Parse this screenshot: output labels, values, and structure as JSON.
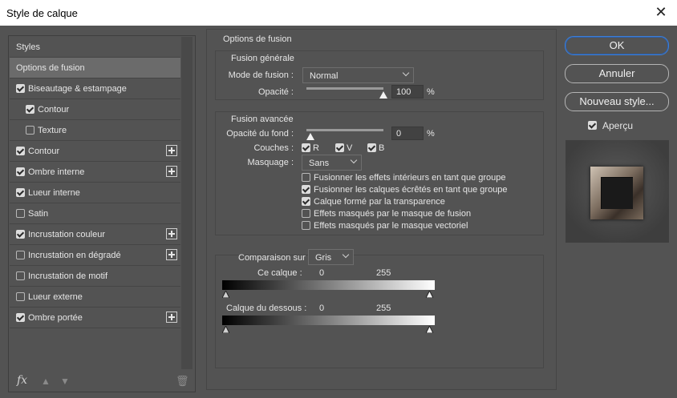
{
  "window": {
    "title": "Style de calque"
  },
  "sidebar": {
    "items": [
      {
        "label": "Styles",
        "checkbox": null,
        "plus": false,
        "selected": false,
        "indent": 0
      },
      {
        "label": "Options de fusion",
        "checkbox": null,
        "plus": false,
        "selected": true,
        "indent": 0
      },
      {
        "label": "Biseautage & estampage",
        "checkbox": true,
        "plus": false,
        "selected": false,
        "indent": 0
      },
      {
        "label": "Contour",
        "checkbox": true,
        "plus": false,
        "selected": false,
        "indent": 1
      },
      {
        "label": "Texture",
        "checkbox": false,
        "plus": false,
        "selected": false,
        "indent": 1
      },
      {
        "label": "Contour",
        "checkbox": true,
        "plus": true,
        "selected": false,
        "indent": 0
      },
      {
        "label": "Ombre interne",
        "checkbox": true,
        "plus": true,
        "selected": false,
        "indent": 0
      },
      {
        "label": "Lueur interne",
        "checkbox": true,
        "plus": false,
        "selected": false,
        "indent": 0
      },
      {
        "label": "Satin",
        "checkbox": false,
        "plus": false,
        "selected": false,
        "indent": 0
      },
      {
        "label": "Incrustation couleur",
        "checkbox": true,
        "plus": true,
        "selected": false,
        "indent": 0
      },
      {
        "label": "Incrustation en dégradé",
        "checkbox": false,
        "plus": true,
        "selected": false,
        "indent": 0
      },
      {
        "label": "Incrustation de motif",
        "checkbox": false,
        "plus": false,
        "selected": false,
        "indent": 0
      },
      {
        "label": "Lueur externe",
        "checkbox": false,
        "plus": false,
        "selected": false,
        "indent": 0
      },
      {
        "label": "Ombre portée",
        "checkbox": true,
        "plus": true,
        "selected": false,
        "indent": 0
      }
    ],
    "footer": {
      "fx_icon": "fx-icon",
      "up_icon": "arrow-up-icon",
      "down_icon": "arrow-down-icon",
      "trash_icon": "trash-icon"
    }
  },
  "fusion": {
    "title": "Options de fusion",
    "generale": {
      "title": "Fusion générale",
      "mode_label": "Mode de fusion :",
      "mode_value": "Normal",
      "opacity_label": "Opacité :",
      "opacity_value": "100",
      "opacity_unit": "%",
      "opacity_level": 1.0
    },
    "avancee": {
      "title": "Fusion avancée",
      "fond_label": "Opacité du fond :",
      "fond_value": "0",
      "fond_unit": "%",
      "fond_level": 0.0,
      "couches_label": "Couches :",
      "couches": [
        {
          "label": "R",
          "checked": true
        },
        {
          "label": "V",
          "checked": true
        },
        {
          "label": "B",
          "checked": true
        }
      ],
      "masquage_label": "Masquage :",
      "masquage_value": "Sans",
      "options": [
        {
          "label": "Fusionner les effets intérieurs en tant que groupe",
          "checked": false
        },
        {
          "label": "Fusionner les calques écrêtés en tant que groupe",
          "checked": true
        },
        {
          "label": "Calque formé par la transparence",
          "checked": true
        },
        {
          "label": "Effets masqués par le masque de fusion",
          "checked": false
        },
        {
          "label": "Effets masqués par le masque vectoriel",
          "checked": false
        }
      ]
    },
    "comparaison": {
      "label": "Comparaison sur :",
      "value": "Gris",
      "ce_calque_label": "Ce calque :",
      "ce_calque_low": "0",
      "ce_calque_high": "255",
      "dessous_label": "Calque du dessous :",
      "dessous_low": "0",
      "dessous_high": "255"
    }
  },
  "buttons": {
    "ok": "OK",
    "cancel": "Annuler",
    "new_style": "Nouveau style...",
    "preview_label": "Aperçu",
    "preview_checked": true
  },
  "colors": {
    "accent": "#3e7fd6",
    "panel": "#535353",
    "selected": "#6b6b6b"
  }
}
